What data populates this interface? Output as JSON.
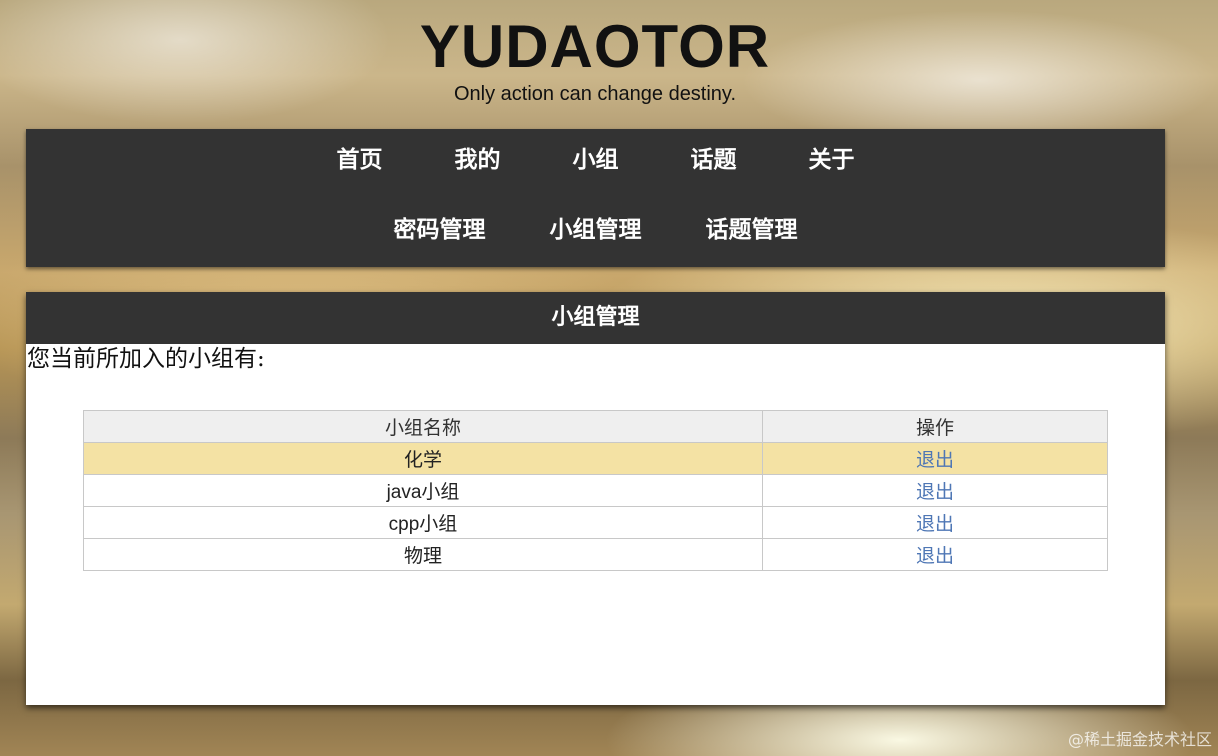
{
  "header": {
    "title": "YUDAOTOR",
    "tagline": "Only action can change destiny."
  },
  "nav": {
    "row1": [
      "首页",
      "我的",
      "小组",
      "话题",
      "关于"
    ],
    "row2": [
      "密码管理",
      "小组管理",
      "话题管理"
    ]
  },
  "panel": {
    "title": "小组管理",
    "intro": "您当前所加入的小组有:",
    "table": {
      "headers": [
        "小组名称",
        "操作"
      ],
      "rows": [
        {
          "name": "化学",
          "action": "退出"
        },
        {
          "name": "java小组",
          "action": "退出"
        },
        {
          "name": "cpp小组",
          "action": "退出"
        },
        {
          "name": "物理",
          "action": "退出"
        }
      ]
    }
  },
  "watermark": "@稀土掘金技术社区",
  "colors": {
    "nav_bg": "#333333",
    "row_highlight": "#f4e2a4",
    "link": "#4f77b5"
  }
}
